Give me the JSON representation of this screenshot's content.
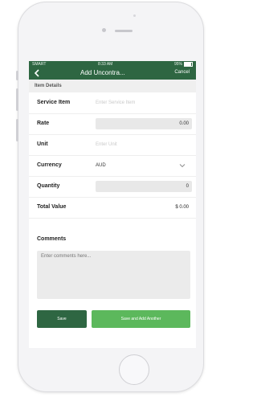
{
  "status_bar": {
    "carrier": "SMART",
    "time": "8:33 AM",
    "battery": "95%"
  },
  "nav": {
    "title": "Add Uncontra...",
    "cancel_label": "Cancel",
    "back_icon": "chevron-left-icon"
  },
  "section": {
    "title": "Item Details"
  },
  "form": {
    "service_item": {
      "label": "Service Item",
      "placeholder": "Enter Service Item",
      "value": ""
    },
    "rate": {
      "label": "Rate",
      "value": "0.00"
    },
    "unit": {
      "label": "Unit",
      "placeholder": "Enter Unit",
      "value": ""
    },
    "currency": {
      "label": "Currency",
      "value": "AUD",
      "icon": "chevron-down-icon"
    },
    "quantity": {
      "label": "Quantity",
      "value": "0"
    },
    "total_value": {
      "label": "Total Value",
      "value": "$ 0.00"
    },
    "comments": {
      "label": "Comments",
      "placeholder": "Enter comments here...",
      "value": ""
    }
  },
  "actions": {
    "save_label": "Save",
    "save_another_label": "Save and Add Another"
  },
  "colors": {
    "header": "#2e6642",
    "primary_button": "#2e6642",
    "secondary_button": "#5cb85c",
    "section_bg": "#efefef"
  }
}
